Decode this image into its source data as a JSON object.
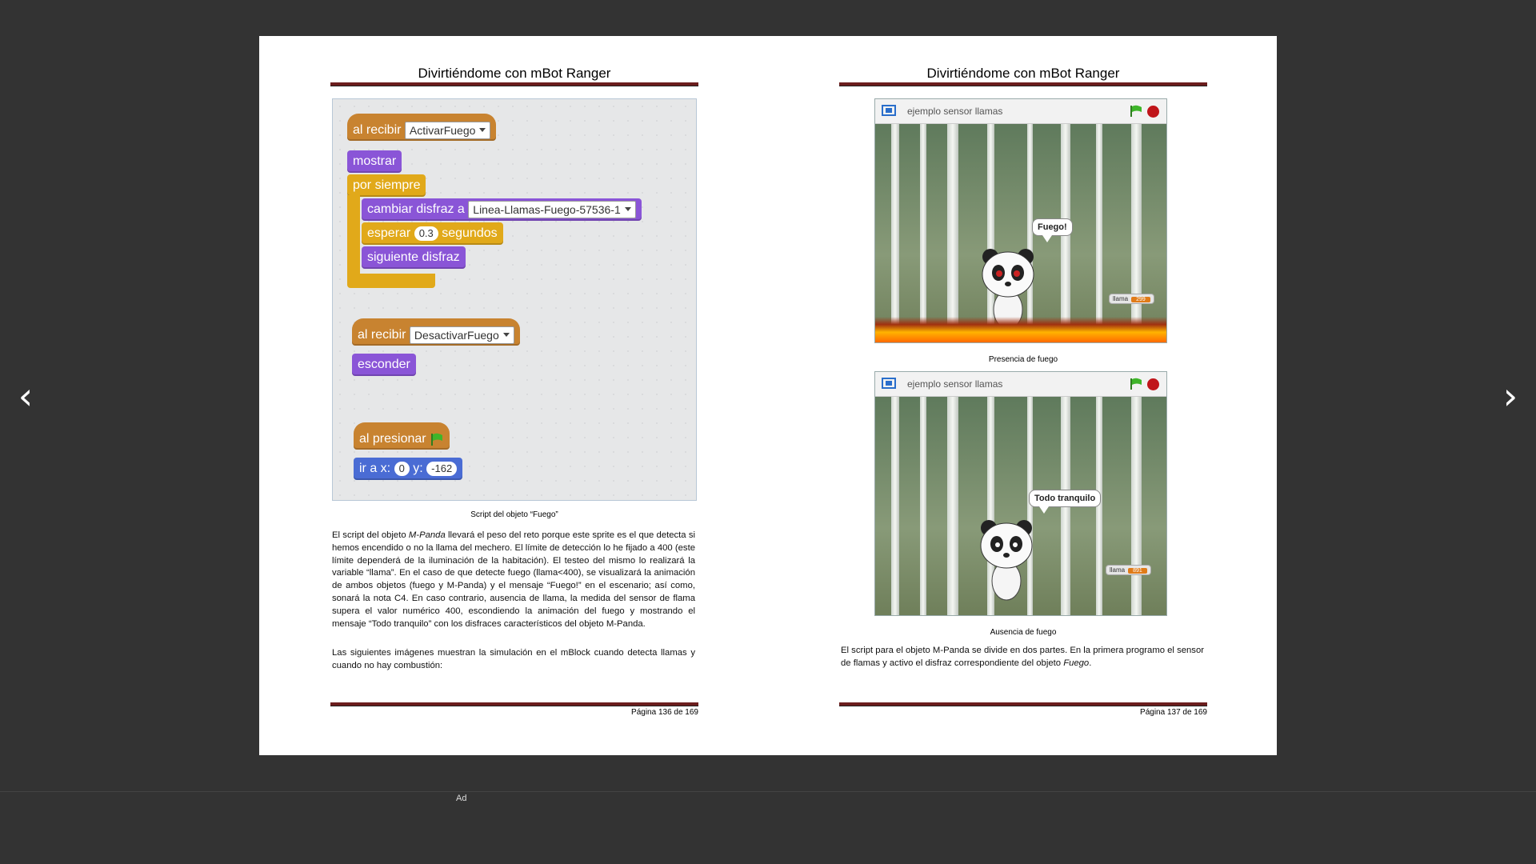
{
  "nav": {
    "prev": "‹",
    "next": "›"
  },
  "left_page": {
    "header": "Divirtiéndome con mBot Ranger",
    "script": {
      "b1_event": "al recibir",
      "b1_dropdown": "ActivarFuego",
      "b2": "mostrar",
      "b3": "por siempre",
      "b4": "cambiar disfraz a",
      "b4_dropdown": "Linea-Llamas-Fuego-57536-1",
      "b5_a": "esperar",
      "b5_num": "0.3",
      "b5_b": "segundos",
      "b6": "siguiente disfraz",
      "b7_event": "al recibir",
      "b7_dropdown": "DesactivarFuego",
      "b8": "esconder",
      "b9_event": "al presionar",
      "b10_a": "ir a x:",
      "b10_x": "0",
      "b10_b": "y:",
      "b10_y": "-162"
    },
    "caption": "Script del objeto “Fuego”",
    "para1_a": "El script del objeto ",
    "para1_italic": "M-Panda",
    "para1_b": " llevará el peso del reto porque este sprite es el que detecta si hemos encendido o no la llama del mechero. El límite de detección lo he fijado a 400 (este límite dependerá de la iluminación de la habitación). El testeo del mismo lo realizará la variable “llama”. En el caso de que detecte fuego (llama<400), se visualizará la animación de ambos objetos (fuego y M-Panda) y el mensaje “Fuego!” en el escenario; así como, sonará la nota C4. En caso contrario, ausencia de llama, la medida del sensor de flama supera el valor numérico 400, escondiendo la animación del fuego y mostrando el mensaje “Todo tranquilo” con los disfraces característicos del objeto M-Panda.",
    "para2": "Las siguientes imágenes muestran la simulación en el mBlock cuando detecta llamas y cuando no hay combustión:",
    "footer": "Página 136 de 169"
  },
  "right_page": {
    "header": "Divirtiéndome con mBot Ranger",
    "stage1": {
      "title": "ejemplo sensor llamas",
      "speech": "Fuego!",
      "monitor_label": "llama",
      "monitor_value": "299"
    },
    "caption1": "Presencia de fuego",
    "stage2": {
      "title": "ejemplo sensor llamas",
      "speech": "Todo tranquilo",
      "monitor_label": "llama",
      "monitor_value": "891"
    },
    "caption2": "Ausencia de fuego",
    "para_a": "El script para el objeto M-Panda se divide en dos partes. En la primera programo el sensor de flamas y activo el disfraz correspondiente del objeto ",
    "para_italic": "Fuego",
    "para_b": ".",
    "footer": "Página 137 de 169"
  },
  "ad_label": "Ad",
  "colors": {
    "background": "#333333",
    "rule": "#6b1d1d",
    "event_block": "#c88330",
    "looks_block": "#8a55d7",
    "control_block": "#e1a91a",
    "motion_block": "#4a6cd4"
  }
}
